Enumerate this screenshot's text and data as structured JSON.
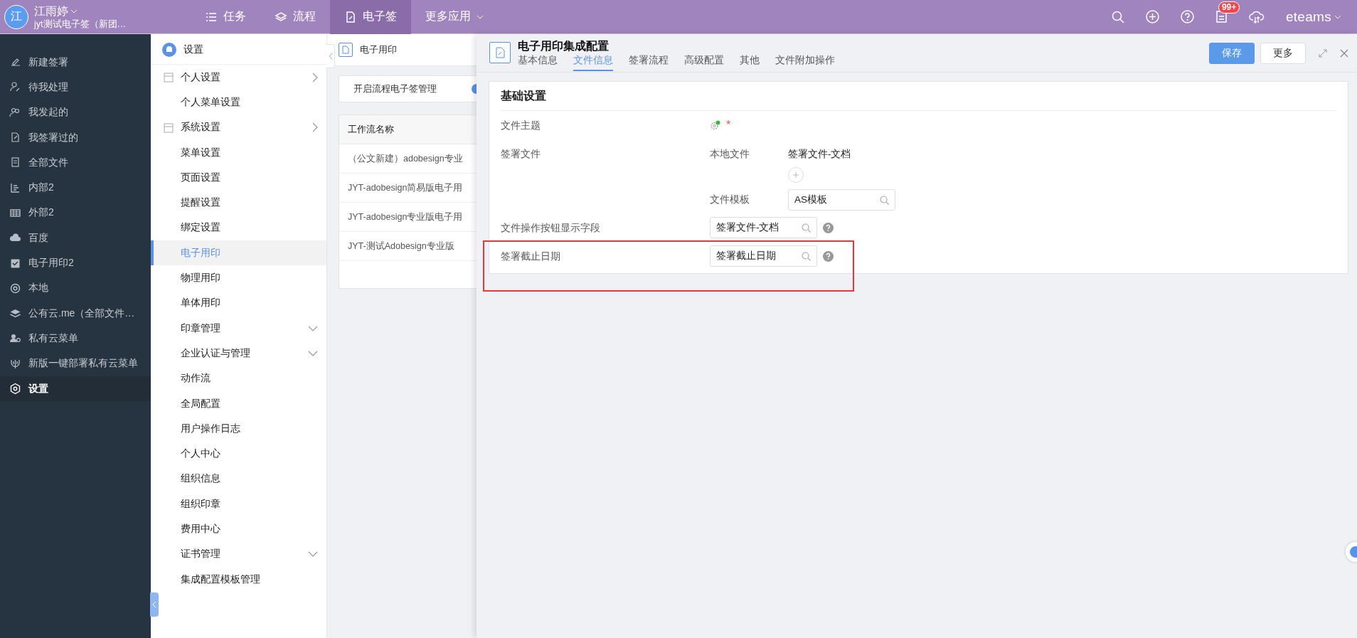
{
  "user": {
    "avatar": "江",
    "name": "江雨婷",
    "org": "jyt测试电子签（新团…"
  },
  "nav": [
    {
      "label": "任务",
      "selected": false
    },
    {
      "label": "流程",
      "selected": false
    },
    {
      "label": "电子签",
      "selected": true
    },
    {
      "label": "更多应用",
      "selected": false
    }
  ],
  "notification_badge": "99+",
  "brand": "eteams",
  "sidebar": {
    "items": [
      {
        "label": "新建签署",
        "selected": false
      },
      {
        "label": "待我处理",
        "selected": false
      },
      {
        "label": "我发起的",
        "selected": false
      },
      {
        "label": "我签署过的",
        "selected": false
      },
      {
        "label": "全部文件",
        "selected": false
      },
      {
        "label": "内部2",
        "selected": false
      },
      {
        "label": "外部2",
        "selected": false
      },
      {
        "label": "百度",
        "selected": false
      },
      {
        "label": "电子用印2",
        "selected": false
      },
      {
        "label": "本地",
        "selected": false
      },
      {
        "label": "公有云.me（全部文件…",
        "selected": false
      },
      {
        "label": "私有云菜单",
        "selected": false
      },
      {
        "label": "新版一键部署私有云菜单",
        "selected": false
      },
      {
        "label": "设置",
        "selected": true
      }
    ]
  },
  "settings_menu": {
    "title": "设置",
    "items": [
      {
        "label": "个人设置",
        "kind": "section",
        "selected": false
      },
      {
        "label": "个人菜单设置",
        "kind": "item",
        "selected": false
      },
      {
        "label": "系统设置",
        "kind": "section",
        "selected": false
      },
      {
        "label": "菜单设置",
        "kind": "item",
        "selected": false
      },
      {
        "label": "页面设置",
        "kind": "item",
        "selected": false
      },
      {
        "label": "提醒设置",
        "kind": "item",
        "selected": false
      },
      {
        "label": "绑定设置",
        "kind": "item",
        "selected": false
      },
      {
        "label": "电子用印",
        "kind": "item",
        "selected": true
      },
      {
        "label": "物理用印",
        "kind": "item",
        "selected": false
      },
      {
        "label": "单体用印",
        "kind": "item",
        "selected": false
      },
      {
        "label": "印章管理",
        "kind": "collapsible",
        "selected": false
      },
      {
        "label": "企业认证与管理",
        "kind": "collapsible",
        "selected": false
      },
      {
        "label": "动作流",
        "kind": "item",
        "selected": false
      },
      {
        "label": "全局配置",
        "kind": "item",
        "selected": false
      },
      {
        "label": "用户操作日志",
        "kind": "item",
        "selected": false
      },
      {
        "label": "个人中心",
        "kind": "item",
        "selected": false
      },
      {
        "label": "组织信息",
        "kind": "item",
        "selected": false
      },
      {
        "label": "组织印章",
        "kind": "item",
        "selected": false
      },
      {
        "label": "费用中心",
        "kind": "item",
        "selected": false
      },
      {
        "label": "证书管理",
        "kind": "collapsible",
        "selected": false
      },
      {
        "label": "集成配置模板管理",
        "kind": "item",
        "selected": false
      }
    ]
  },
  "list_panel": {
    "title": "电子用印",
    "toggle_label": "开启流程电子签管理",
    "toggle_on": true,
    "table": {
      "columns": [
        "工作流名称"
      ],
      "rows": [
        [
          "（公文新建）adobesign专业"
        ],
        [
          "JYT-adobesign简易版电子用"
        ],
        [
          "JYT-adobesign专业版电子用"
        ],
        [
          "JYT-测试Adobesign专业版"
        ]
      ]
    }
  },
  "drawer": {
    "title": "电子用印集成配置",
    "tabs": [
      {
        "label": "基本信息",
        "selected": false
      },
      {
        "label": "文件信息",
        "selected": true
      },
      {
        "label": "签署流程",
        "selected": false
      },
      {
        "label": "高级配置",
        "selected": false
      },
      {
        "label": "其他",
        "selected": false
      },
      {
        "label": "文件附加操作",
        "selected": false
      }
    ],
    "buttons": [
      {
        "label": "保存",
        "kind": "primary"
      },
      {
        "label": "更多",
        "kind": "default"
      }
    ],
    "section": {
      "title": "基础设置",
      "fields": [
        {
          "label": "文件主题",
          "kind": "required-icon",
          "highlighted": false,
          "required_mark": "*"
        },
        {
          "label": "签署文件",
          "kind": "files",
          "highlighted": false,
          "local_label": "本地文件",
          "local_value": "签署文件-文档",
          "template_label": "文件模板",
          "template_value": "AS模板"
        },
        {
          "label": "文件操作按钮显示字段",
          "kind": "select",
          "highlighted": false,
          "value": "签署文件-文档"
        },
        {
          "label": "签署截止日期",
          "kind": "select",
          "highlighted": true,
          "value": "签署截止日期"
        }
      ]
    }
  }
}
